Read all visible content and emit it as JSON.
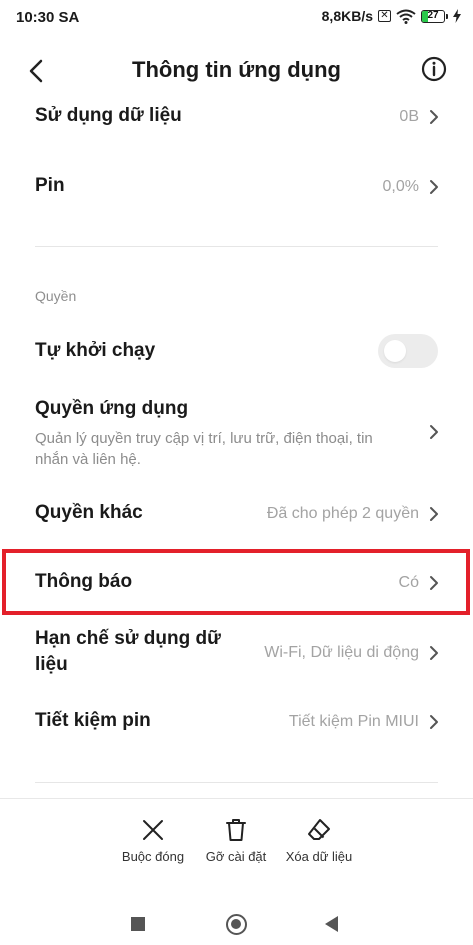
{
  "status_bar": {
    "time": "10:30 SA",
    "net_speed": "8,8KB/s",
    "battery_level": "27",
    "battery_fraction": 0.27
  },
  "header": {
    "title": "Thông tin ứng dụng"
  },
  "rows": {
    "data_usage": {
      "title": "Sử dụng dữ liệu",
      "value": "0B"
    },
    "battery": {
      "title": "Pin",
      "value": "0,0%"
    }
  },
  "permissions": {
    "section_label": "Quyền",
    "autostart": {
      "title": "Tự khởi chạy",
      "enabled": false
    },
    "app_permissions": {
      "title": "Quyền ứng dụng",
      "description": "Quản lý quyền truy cập vị trí, lưu trữ, điện thoại, tin nhắn và liên hệ."
    },
    "other_permissions": {
      "title": "Quyền khác",
      "value": "Đã cho phép 2 quyền"
    },
    "notifications": {
      "title": "Thông báo",
      "value": "Có"
    },
    "restrict_data": {
      "title_line1": "Hạn chế sử dụng dữ",
      "title_line2": "liệu",
      "value": "Wi-Fi, Dữ liệu di động"
    },
    "battery_saver": {
      "title": "Tiết kiệm pin",
      "value": "Tiết kiệm Pin MIUI"
    }
  },
  "actions": {
    "force_stop": "Buộc đóng",
    "uninstall": "Gỡ cài đặt",
    "clear_data": "Xóa dữ liệu"
  },
  "colors": {
    "highlight_border": "#e3202a",
    "battery_fill": "#29c84a"
  }
}
